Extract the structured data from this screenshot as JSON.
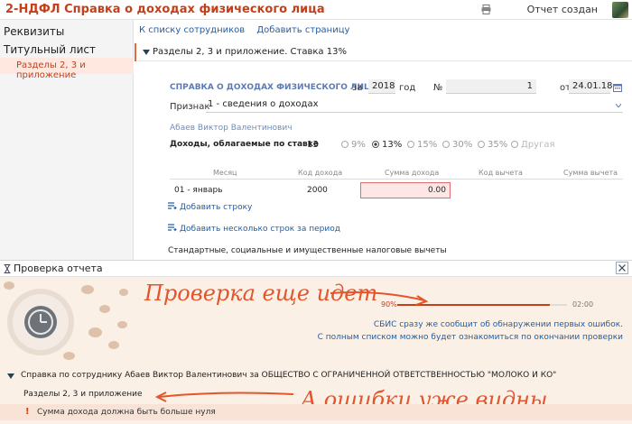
{
  "app": {
    "title": "2-НДФЛ Справка о доходах физического лица",
    "status": "Отчет создан"
  },
  "sidebar": {
    "header": "Реквизиты",
    "items": [
      "Титульный лист",
      "Разделы 2, 3 и приложение"
    ],
    "active_index": 1
  },
  "toolbar": {
    "back_link": "К списку сотрудников",
    "add_page_link": "Добавить страницу"
  },
  "section": {
    "title": "Разделы 2, 3 и приложение. Ставка 13%"
  },
  "form": {
    "title": "СПРАВКА О ДОХОДАХ ФИЗИЧЕСКОГО ЛИЦА",
    "for_label": "за",
    "year": "2018",
    "year_label": "год",
    "number_label": "№",
    "number": "1",
    "from_label": "от",
    "date": "24.01.18",
    "sign_label": "Признак",
    "sign_value": "1 - сведения о доходах",
    "employee": "Абаев Виктор Валентинович",
    "income_label": "Доходы, облагаемые по ставке",
    "income_rate": "13",
    "rates": [
      {
        "label": "9%",
        "state": "unchecked"
      },
      {
        "label": "13%",
        "state": "checked"
      },
      {
        "label": "15%",
        "state": "unchecked"
      },
      {
        "label": "30%",
        "state": "unchecked"
      },
      {
        "label": "35%",
        "state": "unchecked"
      },
      {
        "label": "Другая",
        "state": "disabled"
      }
    ]
  },
  "table": {
    "headers": [
      "Месяц",
      "Код дохода",
      "Сумма дохода",
      "Код вычета",
      "Сумма вычета"
    ],
    "rows": [
      {
        "month": "01 - январь",
        "code": "2000",
        "amount": "0.00",
        "amount_error": true
      }
    ],
    "add_row": "Добавить строку",
    "add_rows_period": "Добавить несколько строк за период"
  },
  "deductions_label": "Стандартные, социальные и имущественные налоговые вычеты",
  "check_panel": {
    "title": "Проверка отчета",
    "progress_percent": "90%",
    "progress_value": 0.9,
    "time": "02:00",
    "info_line1": "СБИС сразу же сообщит об обнаружении первых ошибок.",
    "info_line2": "С полным списком можно будет ознакомиться по окончании проверки",
    "annotation_top": "Проверка еще идет",
    "annotation_bottom": "А ошибки уже видны",
    "report_row": "Справка по сотруднику Абаев Виктор Валентинович за ОБЩЕСТВО С ОГРАНИЧЕННОЙ ОТВЕТСТВЕННОСТЬЮ \"МОЛОКО И КО\"",
    "section_row": "Разделы 2, 3 и приложение",
    "error": "Сумма дохода должна быть больше нуля"
  },
  "colors": {
    "accent": "#c3401b",
    "link": "#205ea8",
    "annotation": "#e5542a",
    "panel_bg": "#fbf0e6"
  }
}
